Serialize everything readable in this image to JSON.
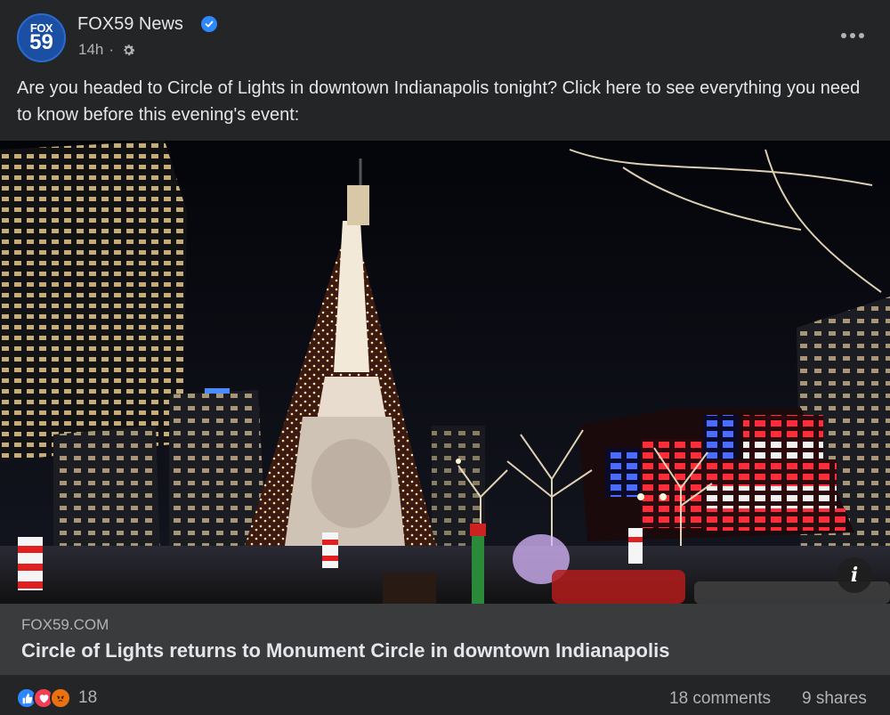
{
  "post": {
    "page_name": "FOX59 News",
    "avatar": {
      "line1": "FOX",
      "line2": "59"
    },
    "time": "14h",
    "separator": "·",
    "text": "Are you headed to Circle of Lights in downtown Indianapolis tonight? Click here to see everything you need to know before this evening's event:"
  },
  "link_preview": {
    "domain": "FOX59.COM",
    "title": "Circle of Lights returns to Monument Circle in downtown Indianapolis",
    "info_icon": "i"
  },
  "footer": {
    "reaction_count": "18",
    "comments": "18 comments",
    "shares": "9 shares"
  },
  "icons": {
    "verified": "verified-badge-icon",
    "privacy": "gear-icon",
    "more": "more-options-icon",
    "reactions": [
      "like-reaction-icon",
      "love-reaction-icon",
      "angry-reaction-icon"
    ]
  },
  "colors": {
    "background": "#242526",
    "link_box": "#3a3b3c",
    "verified": "#2d88ff",
    "like": "#2d88ff",
    "love": "#f33e58",
    "angry": "#e9710f"
  }
}
